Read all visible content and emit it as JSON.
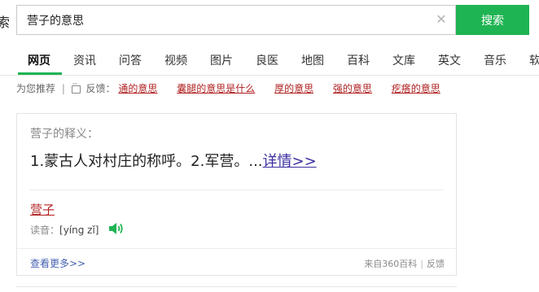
{
  "header": {
    "logo_fragment": "索",
    "search": {
      "value": "营子的意思",
      "placeholder": ""
    },
    "search_button": "搜索"
  },
  "tabs": [
    {
      "label": "网页",
      "active": true
    },
    {
      "label": "资讯"
    },
    {
      "label": "问答"
    },
    {
      "label": "视频"
    },
    {
      "label": "图片"
    },
    {
      "label": "良医"
    },
    {
      "label": "地图"
    },
    {
      "label": "百科"
    },
    {
      "label": "文库"
    },
    {
      "label": "英文"
    },
    {
      "label": "音乐"
    },
    {
      "label": "软"
    }
  ],
  "recommend": {
    "prefix": "为您推荐",
    "feedback": "反馈：",
    "links": [
      "通的意思",
      "囊腿的意思是什么",
      "厚的意思",
      "强的意思",
      "疙瘩的意思"
    ]
  },
  "card": {
    "title": "营子的释义：",
    "definition": "1.蒙古人对村庄的称呼。2.军营。...",
    "detail_link": "详情>>",
    "word": "营子",
    "pron_label": "读音：",
    "pinyin": "[yíng zǐ]",
    "more_link": "查看更多>>",
    "source": "来自360百科",
    "feedback": "反馈"
  },
  "colors": {
    "accent": "#1fb453",
    "link_red": "#b02020",
    "link_purple": "#3a2fa0",
    "link_blue": "#4561b0"
  },
  "icons": {
    "clear": "close-icon",
    "feedback": "feedback-icon",
    "speaker": "speaker-icon"
  }
}
